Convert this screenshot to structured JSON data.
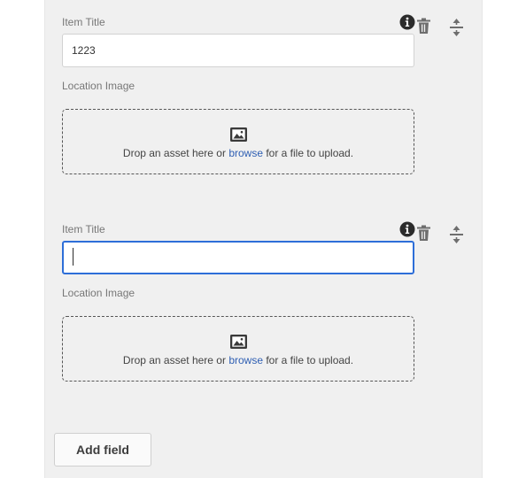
{
  "items": [
    {
      "title_label": "Item Title",
      "title_value": "1223",
      "image_label": "Location Image",
      "drop_text_before": "Drop an asset here or ",
      "browse_link": "browse",
      "drop_text_after": " for a file to upload."
    },
    {
      "title_label": "Item Title",
      "title_value": "",
      "image_label": "Location Image",
      "drop_text_before": "Drop an asset here or ",
      "browse_link": "browse",
      "drop_text_after": " for a file to upload."
    }
  ],
  "actions": {
    "add_field_label": "Add field"
  },
  "icons": {
    "info": "info-icon",
    "delete": "trash-icon",
    "reorder": "drag-handle-icon",
    "image": "image-icon"
  },
  "colors": {
    "panel_background": "#f0f0f0",
    "focus_border": "#2d6ed8",
    "link": "#2f5fb3"
  }
}
